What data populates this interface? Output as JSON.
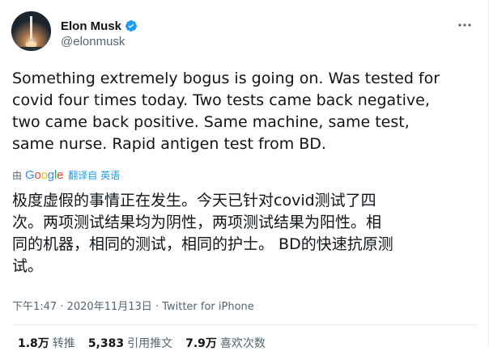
{
  "author": {
    "display_name": "Elon Musk",
    "handle": "@elonmusk"
  },
  "tweet": {
    "text": "Something extremely bogus is going on. Was tested for\ncovid four times today. Two tests came back negative,\ntwo came back positive. Same machine, same test,\nsame nurse. Rapid antigen test from BD."
  },
  "translation": {
    "by_label": "由",
    "provider": "Google",
    "translated_from": "翻译自 英语",
    "text": "极度虚假的事情正在发生。今天已针对covid测试了四\n次。两项测试结果均为阴性，两项测试结果为阳性。相\n同的机器，相同的测试，相同的护士。 BD的快速抗原测\n试。"
  },
  "meta": {
    "time": "下午1:47",
    "separator1": " · ",
    "date": "2020年11月13日",
    "separator2": " · ",
    "source": "Twitter for iPhone"
  },
  "stats": {
    "retweets_value": "1.8万",
    "retweets_label": "转推",
    "quotes_value": "5,383",
    "quotes_label": "引用推文",
    "likes_value": "7.9万",
    "likes_label": "喜欢次数"
  },
  "icons": {
    "verified": "verified-badge-icon",
    "more": "more-options-icon"
  },
  "colors": {
    "accent": "#1d9bf0",
    "text": "#0f1419",
    "secondary_text": "#536471"
  }
}
